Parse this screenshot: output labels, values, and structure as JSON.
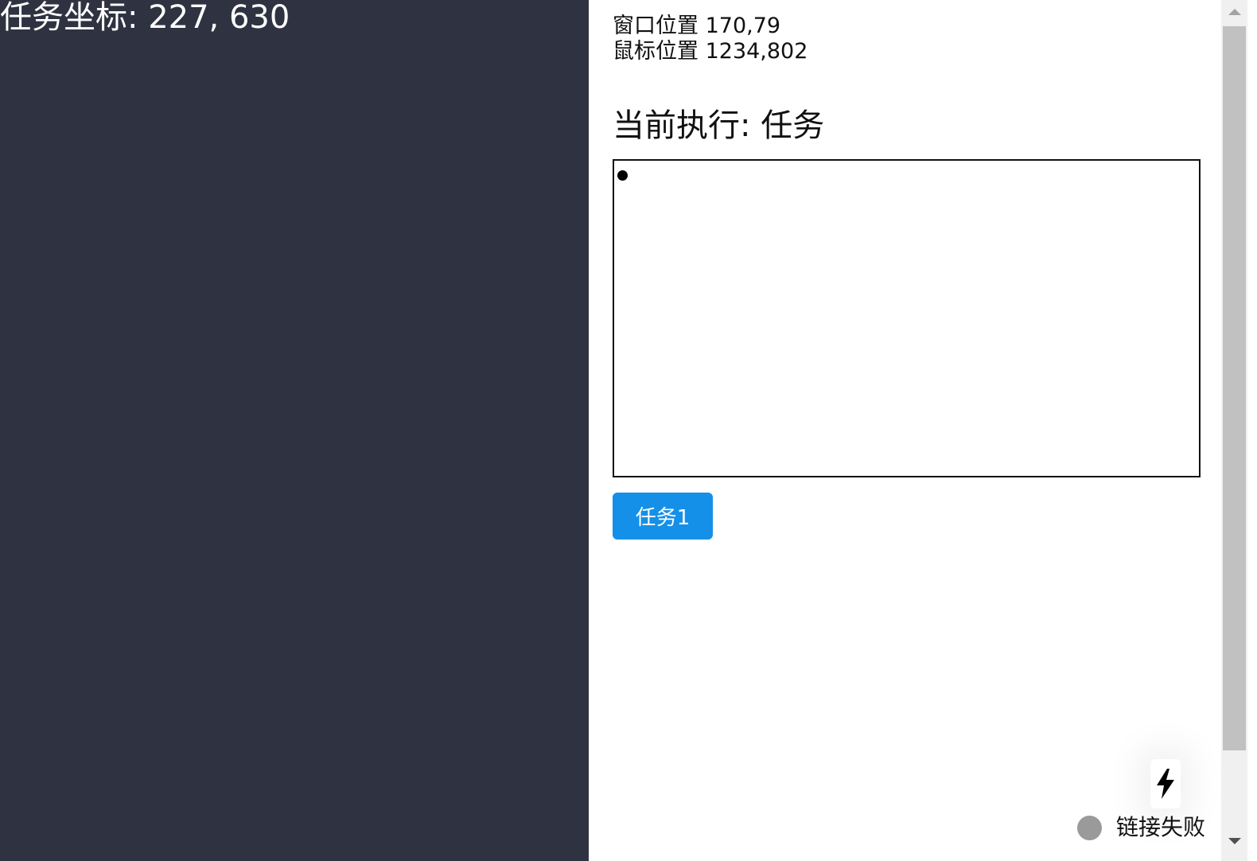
{
  "left_panel": {
    "task_coord_text": "任务坐标: 227, 630",
    "background_color": "#2f3241"
  },
  "info": {
    "window_position": "窗口位置 170,79",
    "mouse_position": "鼠标位置 1234,802"
  },
  "current_task": {
    "label": "当前执行: 任务"
  },
  "task_button": {
    "label": "任务1",
    "color": "#1590e8"
  },
  "bolt_button": {
    "icon": "lightning-bolt-icon"
  },
  "status": {
    "text": "链接失败",
    "dot_color": "#9a9a9a"
  },
  "scrollbar": {
    "up_icon": "scroll-up-arrow-icon",
    "down_icon": "scroll-down-arrow-icon"
  }
}
